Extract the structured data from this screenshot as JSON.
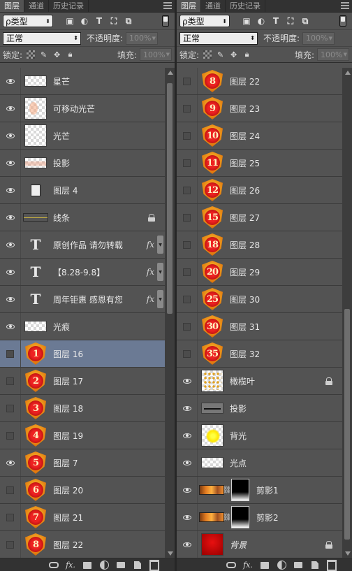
{
  "left_panel": {
    "tabs": [
      "图层",
      "通道",
      "历史记录"
    ],
    "filter": {
      "label": "ρ类型"
    },
    "blend_mode": "正常",
    "opacity_label": "不透明度:",
    "opacity_value": "100%",
    "lock_label": "锁定:",
    "fill_label": "填充:",
    "fill_value": "100%",
    "layers": [
      {
        "name": "星芒",
        "visible": true,
        "thumb": "strip-checker"
      },
      {
        "name": "可移动光芒",
        "visible": true,
        "thumb": "checker-peach"
      },
      {
        "name": "光芒",
        "visible": true,
        "thumb": "checker"
      },
      {
        "name": "投影",
        "visible": true,
        "thumb": "strip-peach"
      },
      {
        "name": "图层 4",
        "visible": true,
        "thumb": "doc"
      },
      {
        "name": "线条",
        "visible": true,
        "thumb": "line",
        "locked": true
      },
      {
        "name": "原创作品 请勿转载",
        "visible": true,
        "thumb": "text",
        "fx": "fx"
      },
      {
        "name": "【8.28-9.8】",
        "visible": true,
        "thumb": "text",
        "fx": "fx"
      },
      {
        "name": "周年钜惠 感恩有您",
        "visible": true,
        "thumb": "text",
        "fx": "fx"
      },
      {
        "name": "光痕",
        "visible": true,
        "thumb": "strip-checker"
      },
      {
        "name": "图层 16",
        "visible": false,
        "thumb": "badge",
        "badge": "1",
        "selected": true
      },
      {
        "name": "图层 17",
        "visible": false,
        "thumb": "badge",
        "badge": "2"
      },
      {
        "name": "图层 18",
        "visible": false,
        "thumb": "badge",
        "badge": "3"
      },
      {
        "name": "图层 19",
        "visible": false,
        "thumb": "badge",
        "badge": "4"
      },
      {
        "name": "图层 7",
        "visible": true,
        "thumb": "badge",
        "badge": "5"
      },
      {
        "name": "图层 20",
        "visible": false,
        "thumb": "badge",
        "badge": "6"
      },
      {
        "name": "图层 21",
        "visible": false,
        "thumb": "badge",
        "badge": "7"
      },
      {
        "name": "图层 22",
        "visible": false,
        "thumb": "badge",
        "badge": "8"
      }
    ]
  },
  "right_panel": {
    "tabs": [
      "图层",
      "通道",
      "历史记录"
    ],
    "filter": {
      "label": "ρ类型"
    },
    "blend_mode": "正常",
    "opacity_label": "不透明度:",
    "opacity_value": "100%",
    "lock_label": "锁定:",
    "fill_label": "填充:",
    "fill_value": "100%",
    "layers": [
      {
        "name": "图层 22",
        "visible": false,
        "thumb": "badge",
        "badge": "8"
      },
      {
        "name": "图层 23",
        "visible": false,
        "thumb": "badge",
        "badge": "9"
      },
      {
        "name": "图层 24",
        "visible": false,
        "thumb": "badge",
        "badge": "10"
      },
      {
        "name": "图层 25",
        "visible": false,
        "thumb": "badge",
        "badge": "11"
      },
      {
        "name": "图层 26",
        "visible": false,
        "thumb": "badge",
        "badge": "12"
      },
      {
        "name": "图层 27",
        "visible": false,
        "thumb": "badge",
        "badge": "15"
      },
      {
        "name": "图层 28",
        "visible": false,
        "thumb": "badge",
        "badge": "18"
      },
      {
        "name": "图层 29",
        "visible": false,
        "thumb": "badge",
        "badge": "20"
      },
      {
        "name": "图层 30",
        "visible": false,
        "thumb": "badge",
        "badge": "25"
      },
      {
        "name": "图层 31",
        "visible": false,
        "thumb": "badge",
        "badge": "30"
      },
      {
        "name": "图层 32",
        "visible": false,
        "thumb": "badge",
        "badge": "35"
      },
      {
        "name": "橄榄叶",
        "visible": true,
        "thumb": "checker-dots",
        "locked": true
      },
      {
        "name": "投影",
        "visible": true,
        "thumb": "shadow"
      },
      {
        "name": "背光",
        "visible": true,
        "thumb": "glow"
      },
      {
        "name": "光点",
        "visible": true,
        "thumb": "strip-checker"
      },
      {
        "name": "剪影1",
        "visible": true,
        "thumb": "fire-mask"
      },
      {
        "name": "剪影2",
        "visible": true,
        "thumb": "fire-mask"
      },
      {
        "name": "背景",
        "visible": true,
        "thumb": "red",
        "locked": true,
        "italic": true
      }
    ]
  },
  "colors": {
    "panel_bg": "#535353",
    "selected_row": "#6b7a94",
    "badge_red": "#e22222",
    "badge_gold": "#ffc433"
  }
}
